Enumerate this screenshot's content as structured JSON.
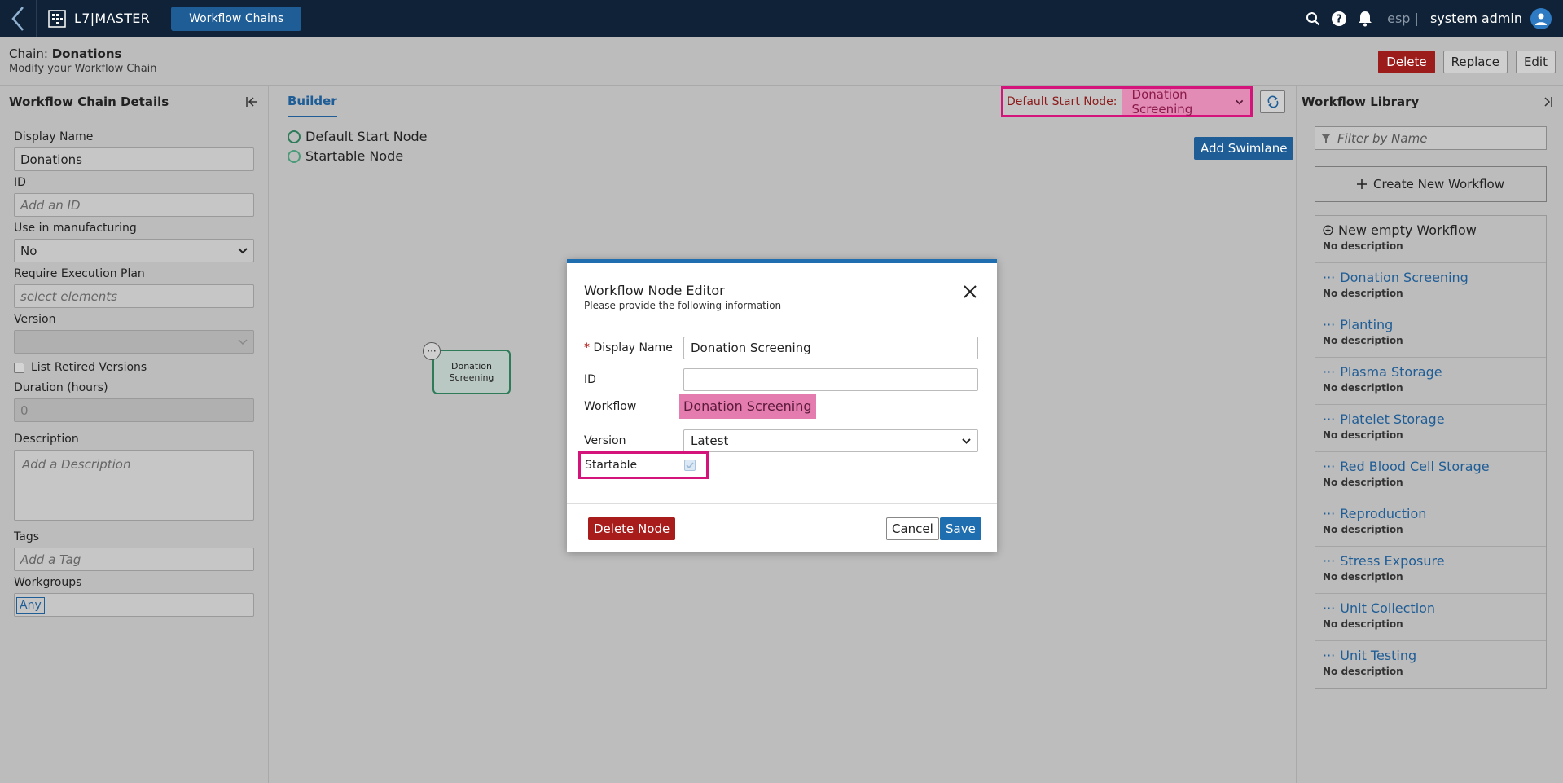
{
  "topbar": {
    "brand": "L7|MASTER",
    "module": "Workflow Chains",
    "lang": "esp |",
    "user": "system admin"
  },
  "header": {
    "chain_label": "Chain:",
    "chain_name": "Donations",
    "subtitle": "Modify your Workflow Chain",
    "delete": "Delete",
    "replace": "Replace",
    "edit": "Edit"
  },
  "left": {
    "title": "Workflow Chain Details",
    "display_name_label": "Display Name",
    "display_name": "Donations",
    "id_label": "ID",
    "id_placeholder": "Add an ID",
    "manufacturing_label": "Use in manufacturing",
    "manufacturing_value": "No",
    "exec_plan_label": "Require Execution Plan",
    "exec_plan_placeholder": "select elements",
    "version_label": "Version",
    "retired_label": "List Retired Versions",
    "duration_label": "Duration (hours)",
    "duration_value": "0",
    "description_label": "Description",
    "description_placeholder": "Add a Description",
    "tags_label": "Tags",
    "tags_placeholder": "Add a Tag",
    "workgroups_label": "Workgroups",
    "workgroup_chip": "Any"
  },
  "builder": {
    "tab": "Builder",
    "dsn_label": "Default Start Node:",
    "dsn_value": "Donation Screening",
    "legend_default": "Default Start Node",
    "legend_startable": "Startable Node",
    "add_swimlane": "Add Swimlane",
    "node_line1": "Donation",
    "node_line2": "Screening",
    "node_menu": "···"
  },
  "library": {
    "title": "Workflow Library",
    "filter_placeholder": "Filter by Name",
    "create": "Create New Workflow",
    "items": [
      {
        "name": "New empty Workflow",
        "desc": "No description"
      },
      {
        "name": "Donation Screening",
        "desc": "No description"
      },
      {
        "name": "Planting",
        "desc": "No description"
      },
      {
        "name": "Plasma Storage",
        "desc": "No description"
      },
      {
        "name": "Platelet Storage",
        "desc": "No description"
      },
      {
        "name": "Red Blood Cell Storage",
        "desc": "No description"
      },
      {
        "name": "Reproduction",
        "desc": "No description"
      },
      {
        "name": "Stress Exposure",
        "desc": "No description"
      },
      {
        "name": "Unit Collection",
        "desc": "No description"
      },
      {
        "name": "Unit Testing",
        "desc": "No description"
      }
    ]
  },
  "modal": {
    "title": "Workflow Node Editor",
    "subtitle": "Please provide the following information",
    "display_name_label": "Display Name",
    "display_name": "Donation Screening",
    "id_label": "ID",
    "workflow_label": "Workflow",
    "workflow_value": "Donation Screening",
    "version_label": "Version",
    "version_value": "Latest",
    "startable_label": "Startable",
    "delete": "Delete Node",
    "cancel": "Cancel",
    "save": "Save"
  },
  "colors": {
    "primary": "#1f5d96",
    "danger": "#9c1c1c",
    "highlight": "#d4147a",
    "navbar": "#0f2237"
  }
}
